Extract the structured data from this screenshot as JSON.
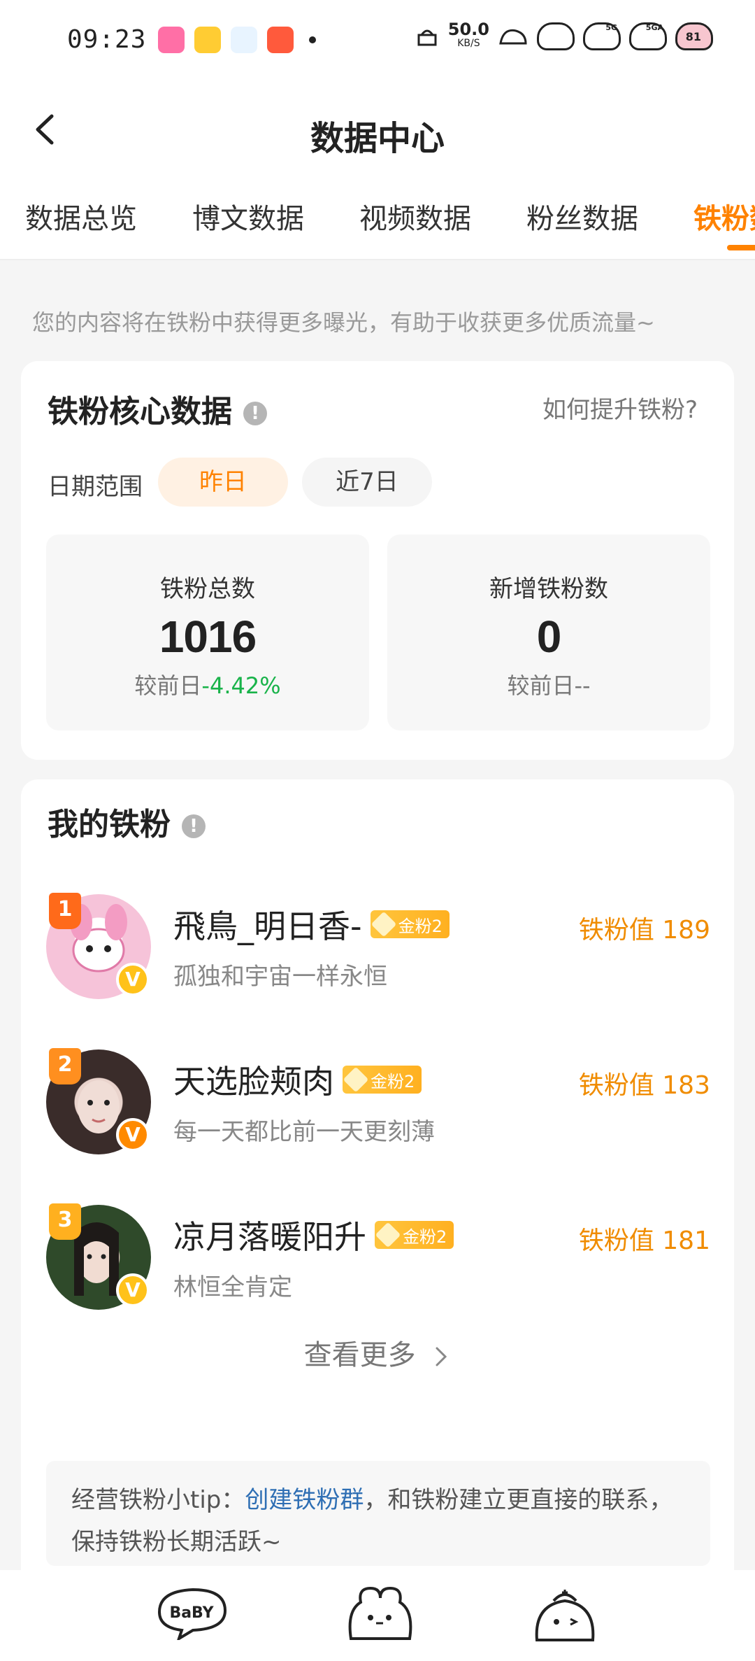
{
  "status_bar": {
    "time": "09:23",
    "net_speed": "50.0",
    "net_unit": "KB/S",
    "signal_labels": [
      "5G",
      "5GA"
    ],
    "battery_text": "81"
  },
  "header": {
    "title": "数据中心"
  },
  "tabs": [
    "数据总览",
    "博文数据",
    "视频数据",
    "粉丝数据",
    "铁粉数据"
  ],
  "active_tab": "铁粉数据",
  "hint": "您的内容将在铁粉中获得更多曝光，有助于收获更多优质流量~",
  "core": {
    "title": "铁粉核心数据",
    "info": "!",
    "how_link": "如何提升铁粉?",
    "date_label": "日期范围",
    "chips": [
      "昨日",
      "近7日"
    ],
    "stats": [
      {
        "label": "铁粉总数",
        "value": "1016",
        "cmp_prefix": "较前日",
        "cmp_value": "-4.42%"
      },
      {
        "label": "新增铁粉数",
        "value": "0",
        "cmp_prefix": "较前日",
        "cmp_value": "--"
      }
    ]
  },
  "fans": {
    "title": "我的铁粉",
    "info": "!",
    "list": [
      {
        "rank": "1",
        "name": "飛鳥_明日香-",
        "badge": "金粉2",
        "signature": "孤独和宇宙一样永恒",
        "score": "铁粉值 189",
        "rank_color": "#ff6a1a",
        "avatar_color": "#f6c3d9"
      },
      {
        "rank": "2",
        "name": "天选脸颊肉",
        "badge": "金粉2",
        "signature": "每一天都比前一天更刻薄",
        "score": "铁粉值 183",
        "rank_color": "#ff8f1f",
        "avatar_color": "#5a4a48"
      },
      {
        "rank": "3",
        "name": "凉月落暖阳升",
        "badge": "金粉2",
        "signature": "林恒全肯定",
        "score": "铁粉值 181",
        "rank_color": "#ffb01f",
        "avatar_color": "#3d5a36"
      }
    ],
    "verified": "V",
    "more": "查看更多",
    "tip_prefix": "经营铁粉小tip：",
    "tip_link": "创建铁粉群",
    "tip_suffix": "，和铁粉建立更直接的联系，保持铁粉长期活跃~"
  },
  "bottom_bar": {
    "items": [
      "BaBY",
      "",
      ""
    ]
  },
  "colors": {
    "accent": "#ff8200",
    "score": "#f08c00",
    "positive_negative": "#19b34a",
    "link": "#2f6fb4"
  }
}
